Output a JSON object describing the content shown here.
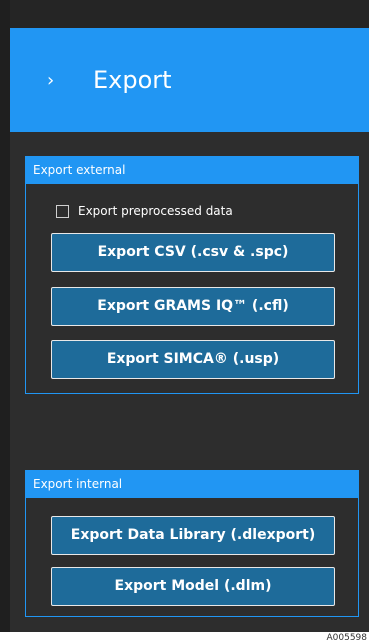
{
  "header": {
    "chevron_icon": "chevron-right-icon",
    "chevron_glyph": "›",
    "title": "Export"
  },
  "export_external": {
    "title": "Export external",
    "checkbox_label": "Export preprocessed data",
    "checkbox_checked": false,
    "buttons": [
      {
        "label": "Export CSV  (.csv & .spc)"
      },
      {
        "label": "Export GRAMS IQ™  (.cfl)"
      },
      {
        "label": "Export SIMCA®  (.usp)"
      }
    ]
  },
  "export_internal": {
    "title": "Export internal",
    "buttons": [
      {
        "label": "Export Data Library  (.dlexport)"
      },
      {
        "label": "Export Model  (.dlm)"
      }
    ]
  },
  "footer": {
    "doc_id": "A005598"
  },
  "colors": {
    "accent": "#2196f3",
    "panel": "#2d2d2d",
    "button": "#1e6b9a"
  }
}
